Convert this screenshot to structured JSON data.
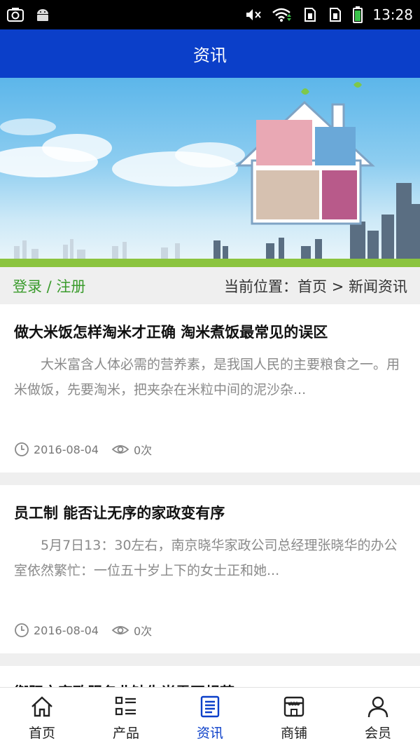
{
  "status_bar": {
    "time": "13:28",
    "icons": [
      "screenshot-icon",
      "android-icon",
      "mute-icon",
      "wifi-icon",
      "sim1-icon",
      "sim2-icon",
      "battery-icon"
    ]
  },
  "header": {
    "title": "资讯"
  },
  "location_bar": {
    "login_label": "登录 / 注册",
    "path": "当前位置：首页 > 新闻资讯"
  },
  "articles": [
    {
      "title": "做大米饭怎样淘米才正确 淘米煮饭最常见的误区",
      "summary": "大米富含人体必需的营养素，是我国人民的主要粮食之一。用米做饭，先要淘米，把夹杂在米粒中间的泥沙杂...",
      "date": "2016-08-04",
      "views": "0次"
    },
    {
      "title": "员工制 能否让无序的家政变有序",
      "summary": "5月7日13：30左右，南京晓华家政公司总经理张晓华的办公室依然繁忙：一位五十岁上下的女士正和她...",
      "date": "2016-08-04",
      "views": "0次"
    },
    {
      "title": "衡阳市家政服务业缺失尚需再规范",
      "summary": "",
      "date": "",
      "views": ""
    }
  ],
  "bottom_nav": [
    {
      "label": "首页",
      "icon": "home-icon"
    },
    {
      "label": "产品",
      "icon": "list-icon"
    },
    {
      "label": "资讯",
      "icon": "news-icon",
      "active": true
    },
    {
      "label": "商铺",
      "icon": "shop-icon"
    },
    {
      "label": "会员",
      "icon": "user-icon"
    }
  ],
  "colors": {
    "header_bg": "#0b3fc9",
    "login_link": "#3a9b2c",
    "active_nav": "#0b3fc9"
  }
}
